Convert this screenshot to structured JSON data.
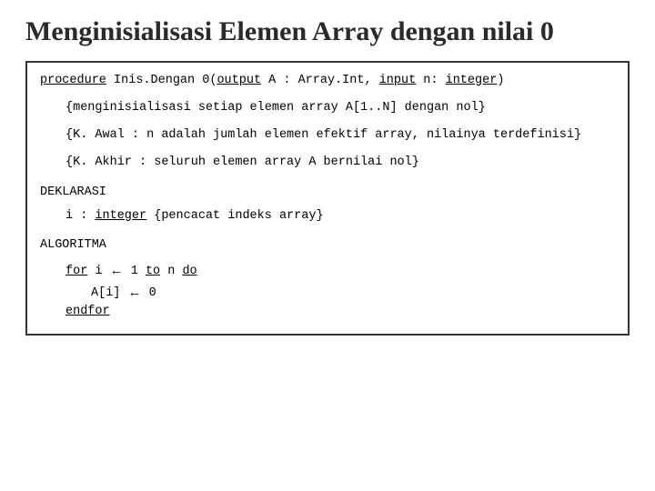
{
  "title": "Menginisialisasi Elemen Array dengan nilai 0",
  "sig": {
    "kw_procedure": "procedure",
    "name": " Inis.Dengan 0(",
    "kw_output": "output",
    "mid1": " A : Array.Int, ",
    "kw_input": "input",
    "mid2": " n: ",
    "kw_integer": "integer",
    "end": ")"
  },
  "comments": {
    "c1": "{menginisialisasi setiap elemen array A[1..N] dengan nol}",
    "c2": "{K. Awal : n adalah jumlah elemen efektif array, nilainya terdefinisi}",
    "c3": "{K. Akhir : seluruh elemen array A bernilai nol}"
  },
  "deklarasi": {
    "label": "DEKLARASI",
    "pre": "i : ",
    "kw_integer": "integer",
    "post": " {pencacat indeks array}"
  },
  "algoritma": {
    "label": "ALGORITMA",
    "kw_for": "for",
    "after_for": " i ",
    "arrow": "←",
    "one": " 1 ",
    "kw_to": "to",
    "n": " n ",
    "kw_do": "do",
    "body_pre": "A[i] ",
    "body_post": " 0",
    "kw_endfor": "endfor"
  }
}
